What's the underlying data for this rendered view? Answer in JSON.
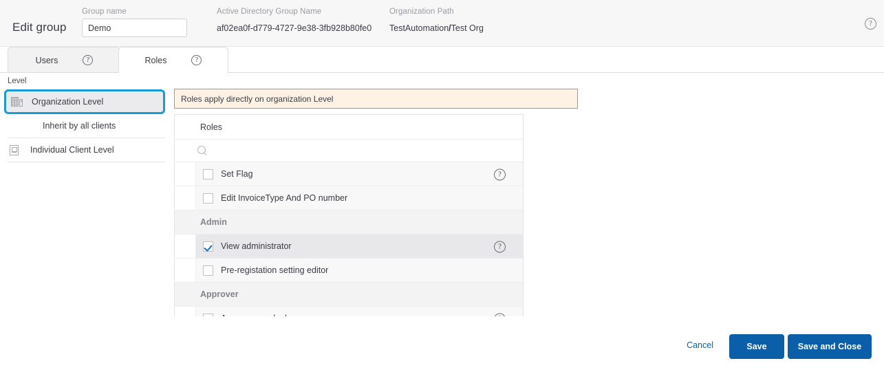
{
  "header": {
    "title": "Edit group",
    "group_name": {
      "label": "Group name",
      "value": "Demo",
      "placeholder": ""
    },
    "ad_group_name": {
      "label": "Active Directory Group Name",
      "value": "af02ea0f-d779-4727-9e38-3fb928b80fe0"
    },
    "org_path": {
      "label": "Organization Path",
      "root": "TestAutomation",
      "separator": "/",
      "leaf": "Test Org"
    },
    "help_icon": "help-circle-icon",
    "help_glyph": "?"
  },
  "tabs": [
    {
      "label": "Users",
      "active": false,
      "help_glyph": "?"
    },
    {
      "label": "Roles",
      "active": true,
      "help_glyph": "?"
    }
  ],
  "level": {
    "caption": "Level",
    "items": [
      {
        "label": "Organization Level",
        "icon": "building-icon",
        "selected": true
      },
      {
        "label": "Inherit by all clients",
        "icon": "",
        "selected": false
      },
      {
        "label": "Individual Client Level",
        "icon": "client-icon",
        "selected": false
      }
    ]
  },
  "notice": {
    "text": "Roles apply directly on organization Level"
  },
  "roles_panel": {
    "header": "Roles",
    "search": {
      "value": "",
      "placeholder": ""
    },
    "rows": [
      {
        "kind": "role",
        "label": "Set Flag",
        "checked": false,
        "has_help": true,
        "highlighted": false
      },
      {
        "kind": "role",
        "label": "Edit InvoiceType And PO number",
        "checked": false,
        "has_help": false,
        "highlighted": false
      },
      {
        "kind": "group",
        "label": "Admin"
      },
      {
        "kind": "role",
        "label": "View administrator",
        "checked": true,
        "has_help": true,
        "highlighted": true
      },
      {
        "kind": "role",
        "label": "Pre-registation setting editor",
        "checked": false,
        "has_help": false,
        "highlighted": false
      },
      {
        "kind": "group",
        "label": "Approver"
      },
      {
        "kind": "role",
        "label": "Approver readonly",
        "checked": false,
        "has_help": true,
        "highlighted": false
      }
    ]
  },
  "footer": {
    "cancel_label": "Cancel",
    "save_label": "Save",
    "save_close_label": "Save and Close"
  },
  "colors": {
    "primary_button": "#0b5ea8",
    "link": "#0b5ea8",
    "selection_ring": "#1b9ad8",
    "notice_border": "#dd8c22",
    "notice_background": "#fdf2e4",
    "checkmark": "#0f6fc5"
  }
}
